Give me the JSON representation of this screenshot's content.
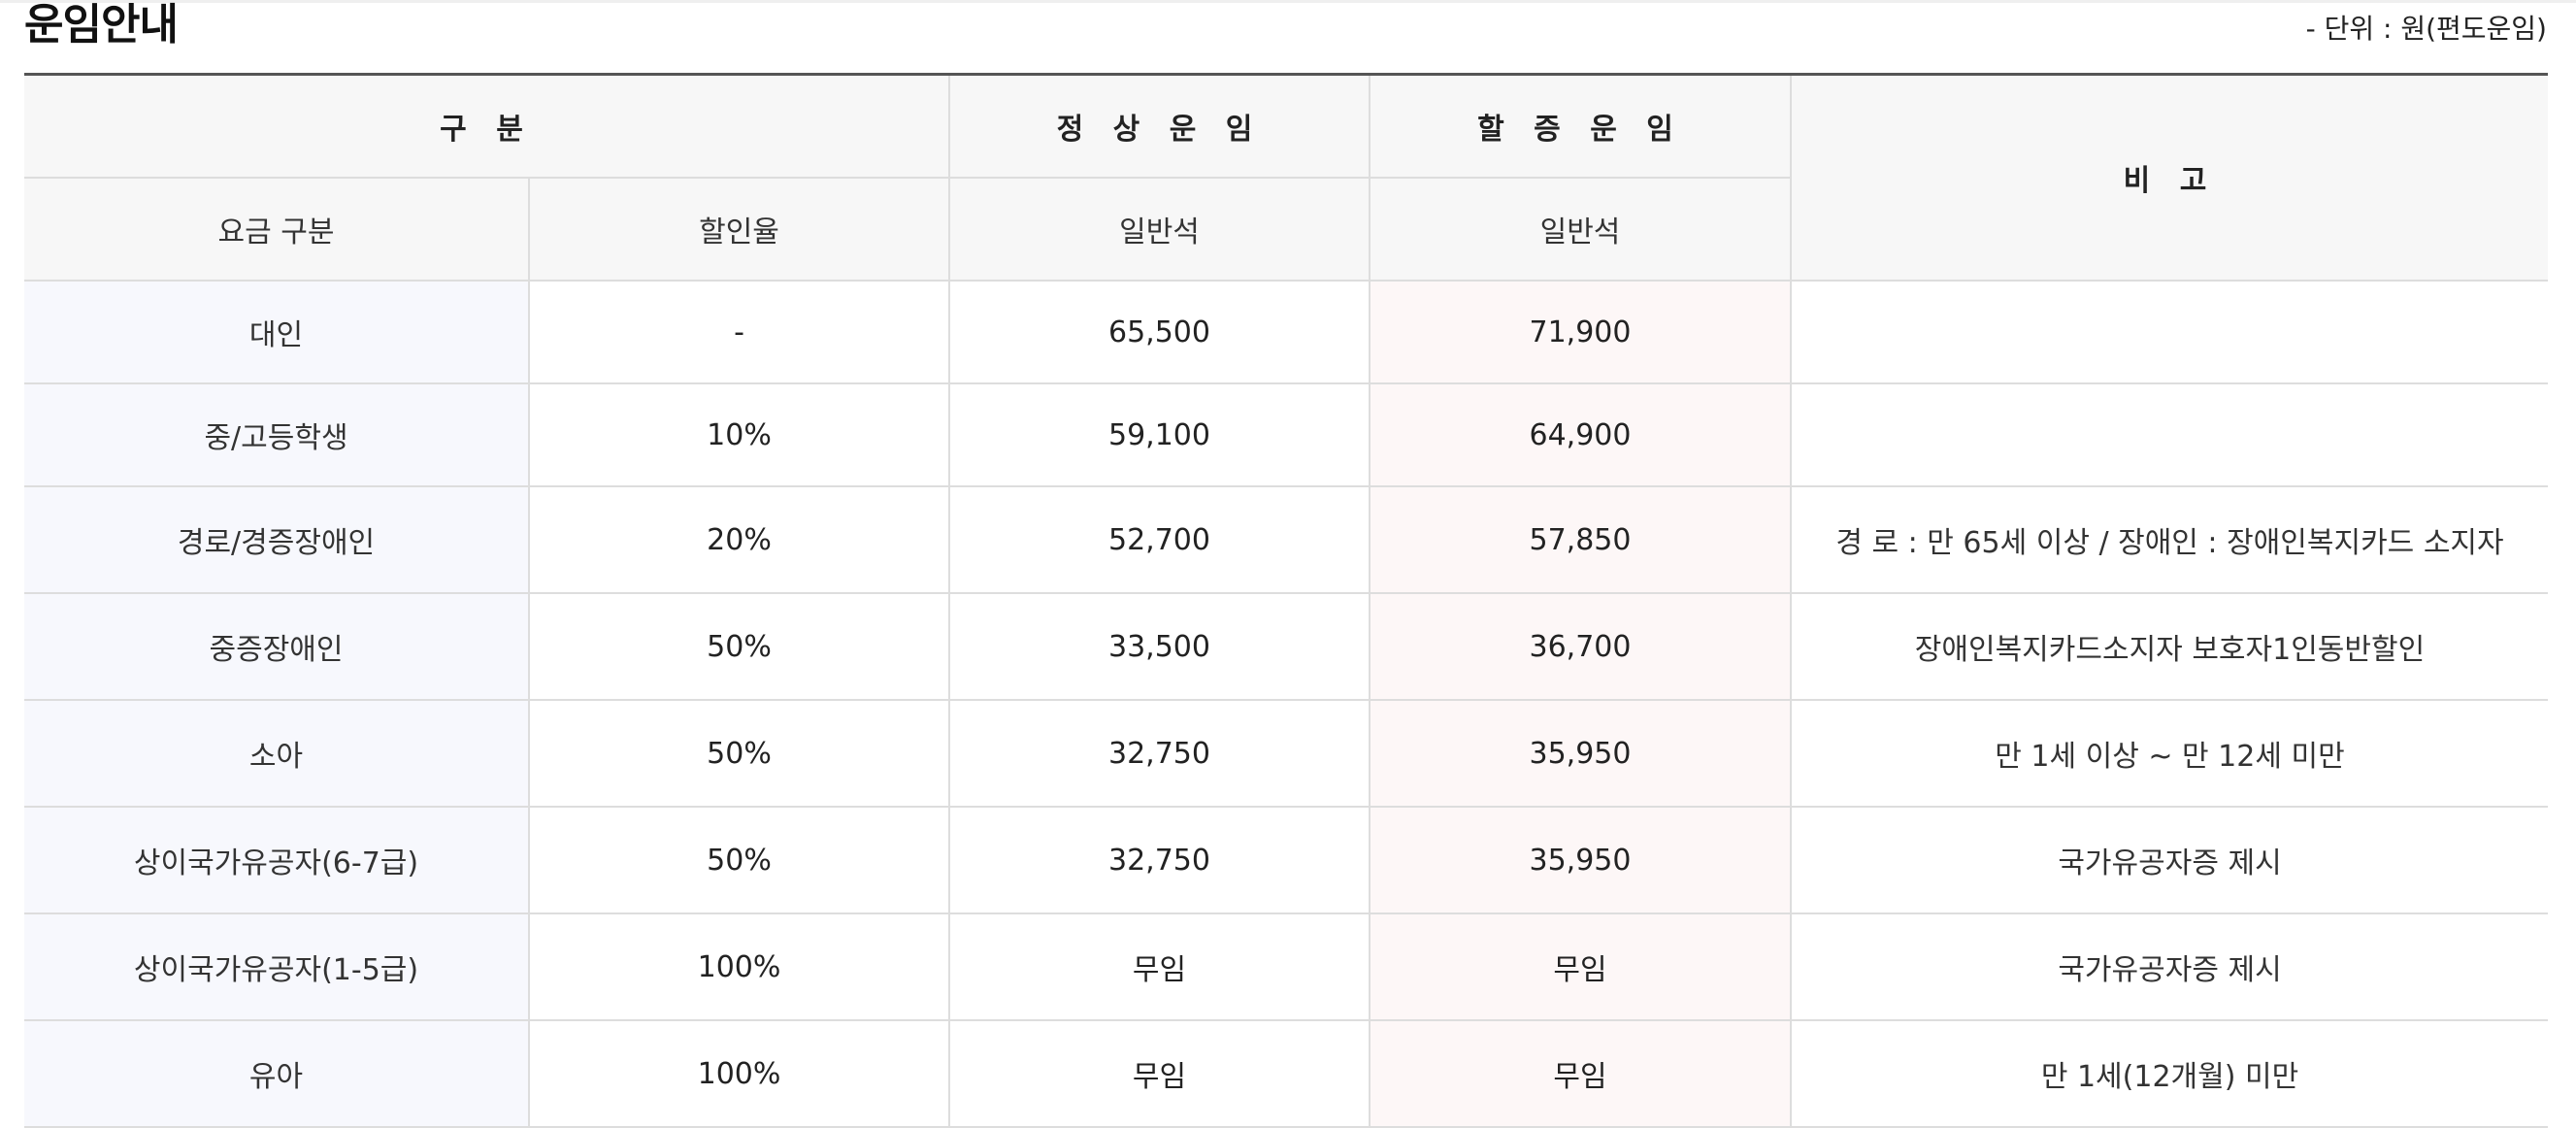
{
  "page": {
    "title": "운임안내",
    "unit_note": "- 단위 : 원(편도운임)"
  },
  "table": {
    "group_headers": {
      "category": "구 분",
      "normal_fare": "정 상 운 임",
      "surge_fare": "할 증 운 임",
      "remarks": "비 고"
    },
    "sub_headers": {
      "fare_type": "요금 구분",
      "discount_rate": "할인율",
      "normal_seat": "일반석",
      "surge_seat": "일반석"
    },
    "rows": [
      {
        "type": "대인",
        "discount": "-",
        "normal": "65,500",
        "surge": "71,900",
        "note": ""
      },
      {
        "type": "중/고등학생",
        "discount": "10%",
        "normal": "59,100",
        "surge": "64,900",
        "note": ""
      },
      {
        "type": "경로/경증장애인",
        "discount": "20%",
        "normal": "52,700",
        "surge": "57,850",
        "note": "경 로 : 만 65세 이상 / 장애인 : 장애인복지카드 소지자"
      },
      {
        "type": "중증장애인",
        "discount": "50%",
        "normal": "33,500",
        "surge": "36,700",
        "note": "장애인복지카드소지자 보호자1인동반할인"
      },
      {
        "type": "소아",
        "discount": "50%",
        "normal": "32,750",
        "surge": "35,950",
        "note": "만 1세 이상 ~ 만 12세 미만"
      },
      {
        "type": "상이국가유공자(6-7급)",
        "discount": "50%",
        "normal": "32,750",
        "surge": "35,950",
        "note": "국가유공자증 제시"
      },
      {
        "type": "상이국가유공자(1-5급)",
        "discount": "100%",
        "normal": "무임",
        "surge": "무임",
        "note": "국가유공자증 제시"
      },
      {
        "type": "유아",
        "discount": "100%",
        "normal": "무임",
        "surge": "무임",
        "note": "만 1세(12개월) 미만"
      }
    ]
  },
  "colors": {
    "header_bg": "#f7f7f7",
    "category_bg": "#f7f8fd",
    "surge_bg": "#fdf7f7",
    "border": "#dddddd",
    "title_rule": "#555555"
  }
}
